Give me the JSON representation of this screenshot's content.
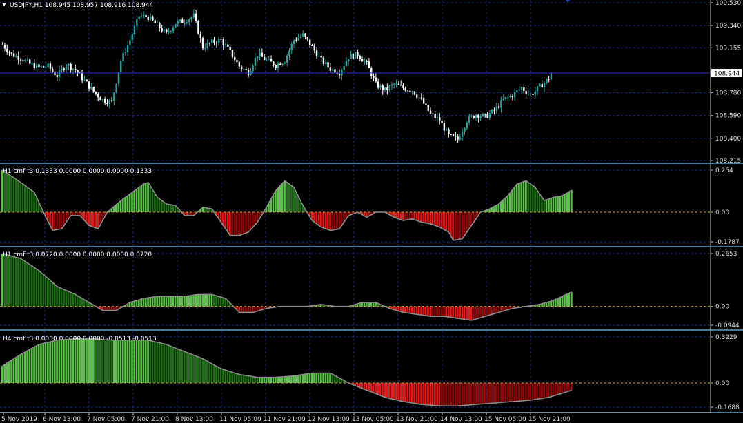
{
  "colors": {
    "background": "#000000",
    "grid": "#1c2b6b",
    "bull": "#2aa198",
    "bear": "#ffffff",
    "price_line": "#2b38c8",
    "separator": "#5fa0c8",
    "zero_line": "#c8b04a",
    "green_strong": "#5cc04a",
    "green_dark": "#1f6b16",
    "red_strong": "#e01818",
    "red_dark": "#8c0808",
    "curve": "#8c8c8c"
  },
  "chart_data": [
    {
      "type": "candlestick",
      "header": "USDJPY,H1  108.945 108.957 108.916 108.944",
      "y_ticks": [
        "109.530",
        "109.340",
        "109.155",
        "108.780",
        "108.590",
        "108.400",
        "108.215"
      ],
      "ylim": [
        108.215,
        109.53
      ],
      "current_price": "108.944",
      "close_path": [
        [
          0,
          109.18
        ],
        [
          4,
          109.1
        ],
        [
          8,
          109.07
        ],
        [
          12,
          109.02
        ],
        [
          16,
          108.99
        ],
        [
          20,
          109.0
        ],
        [
          24,
          108.92
        ],
        [
          28,
          109.02
        ],
        [
          32,
          108.97
        ],
        [
          36,
          108.88
        ],
        [
          40,
          108.79
        ],
        [
          44,
          108.72
        ],
        [
          48,
          108.7
        ],
        [
          52,
          109.05
        ],
        [
          56,
          109.22
        ],
        [
          60,
          109.42
        ],
        [
          64,
          109.41
        ],
        [
          68,
          109.34
        ],
        [
          72,
          109.27
        ],
        [
          76,
          109.36
        ],
        [
          80,
          109.38
        ],
        [
          84,
          109.42
        ],
        [
          88,
          109.16
        ],
        [
          92,
          109.2
        ],
        [
          96,
          109.22
        ],
        [
          100,
          109.12
        ],
        [
          104,
          109.0
        ],
        [
          108,
          108.95
        ],
        [
          112,
          109.1
        ],
        [
          116,
          109.05
        ],
        [
          120,
          109.01
        ],
        [
          124,
          109.05
        ],
        [
          128,
          109.22
        ],
        [
          132,
          109.26
        ],
        [
          136,
          109.16
        ],
        [
          140,
          109.05
        ],
        [
          144,
          108.98
        ],
        [
          148,
          108.95
        ],
        [
          152,
          109.08
        ],
        [
          156,
          109.1
        ],
        [
          160,
          109.02
        ],
        [
          164,
          108.85
        ],
        [
          168,
          108.8
        ],
        [
          172,
          108.85
        ],
        [
          176,
          108.82
        ],
        [
          180,
          108.8
        ],
        [
          184,
          108.72
        ],
        [
          188,
          108.6
        ],
        [
          192,
          108.55
        ],
        [
          196,
          108.42
        ],
        [
          200,
          108.39
        ],
        [
          204,
          108.55
        ],
        [
          208,
          108.6
        ],
        [
          212,
          108.58
        ],
        [
          216,
          108.63
        ],
        [
          220,
          108.72
        ],
        [
          224,
          108.76
        ],
        [
          228,
          108.82
        ],
        [
          232,
          108.76
        ],
        [
          236,
          108.83
        ],
        [
          240,
          108.9
        ],
        [
          241,
          108.944
        ]
      ]
    },
    {
      "type": "histogram",
      "header": "H1 cmf t3  0.1333 0.0000 0.0000 0.0000 0.1333",
      "y_ticks": [
        "0.254",
        "0.00",
        "-0.1787"
      ],
      "ylim": [
        -0.1787,
        0.254
      ],
      "values_path": [
        [
          0,
          0.254
        ],
        [
          8,
          0.18
        ],
        [
          14,
          0.12
        ],
        [
          18,
          0.0
        ],
        [
          22,
          -0.11
        ],
        [
          26,
          -0.1
        ],
        [
          30,
          -0.02
        ],
        [
          34,
          -0.02
        ],
        [
          38,
          -0.08
        ],
        [
          42,
          -0.1
        ],
        [
          46,
          0.0
        ],
        [
          52,
          0.07
        ],
        [
          58,
          0.13
        ],
        [
          62,
          0.17
        ],
        [
          64,
          0.18
        ],
        [
          68,
          0.09
        ],
        [
          72,
          0.05
        ],
        [
          76,
          0.04
        ],
        [
          80,
          -0.02
        ],
        [
          84,
          -0.02
        ],
        [
          88,
          0.03
        ],
        [
          92,
          0.02
        ],
        [
          96,
          -0.06
        ],
        [
          100,
          -0.14
        ],
        [
          104,
          -0.14
        ],
        [
          108,
          -0.12
        ],
        [
          112,
          -0.06
        ],
        [
          116,
          0.03
        ],
        [
          120,
          0.13
        ],
        [
          124,
          0.19
        ],
        [
          128,
          0.15
        ],
        [
          132,
          0.04
        ],
        [
          136,
          -0.05
        ],
        [
          140,
          -0.09
        ],
        [
          144,
          -0.11
        ],
        [
          148,
          -0.1
        ],
        [
          152,
          -0.02
        ],
        [
          156,
          -0.0
        ],
        [
          160,
          -0.03
        ],
        [
          164,
          0.0
        ],
        [
          168,
          0.0
        ],
        [
          172,
          -0.03
        ],
        [
          176,
          -0.05
        ],
        [
          180,
          -0.04
        ],
        [
          184,
          -0.06
        ],
        [
          188,
          -0.07
        ],
        [
          192,
          -0.09
        ],
        [
          196,
          -0.12
        ],
        [
          198,
          -0.17
        ],
        [
          202,
          -0.16
        ],
        [
          206,
          -0.08
        ],
        [
          210,
          0.0
        ],
        [
          214,
          0.02
        ],
        [
          218,
          0.05
        ],
        [
          222,
          0.1
        ],
        [
          226,
          0.17
        ],
        [
          230,
          0.19
        ],
        [
          234,
          0.15
        ],
        [
          238,
          0.07
        ],
        [
          242,
          0.09
        ],
        [
          246,
          0.1
        ],
        [
          250,
          0.1333
        ]
      ]
    },
    {
      "type": "histogram",
      "header": "H1 cmf t3  0.0720 0.0000 0.0000 0.0000 0.0720",
      "y_ticks": [
        "0.2653",
        "0.00",
        "-0.0944"
      ],
      "ylim": [
        -0.0944,
        0.2653
      ],
      "values_path": [
        [
          0,
          0.2653
        ],
        [
          8,
          0.24
        ],
        [
          16,
          0.18
        ],
        [
          24,
          0.1
        ],
        [
          32,
          0.06
        ],
        [
          38,
          0.02
        ],
        [
          44,
          -0.02
        ],
        [
          50,
          -0.02
        ],
        [
          56,
          0.02
        ],
        [
          62,
          0.04
        ],
        [
          68,
          0.05
        ],
        [
          74,
          0.05
        ],
        [
          80,
          0.05
        ],
        [
          86,
          0.06
        ],
        [
          92,
          0.06
        ],
        [
          98,
          0.04
        ],
        [
          104,
          -0.03
        ],
        [
          110,
          -0.03
        ],
        [
          116,
          -0.01
        ],
        [
          122,
          0.0
        ],
        [
          128,
          0.0
        ],
        [
          134,
          0.0
        ],
        [
          140,
          0.01
        ],
        [
          146,
          0.0
        ],
        [
          152,
          -0.0
        ],
        [
          158,
          0.02
        ],
        [
          164,
          0.02
        ],
        [
          170,
          -0.01
        ],
        [
          176,
          -0.03
        ],
        [
          182,
          -0.04
        ],
        [
          188,
          -0.05
        ],
        [
          194,
          -0.05
        ],
        [
          200,
          -0.06
        ],
        [
          206,
          -0.07
        ],
        [
          212,
          -0.05
        ],
        [
          218,
          -0.03
        ],
        [
          224,
          -0.01
        ],
        [
          230,
          0.0
        ],
        [
          236,
          0.01
        ],
        [
          242,
          0.03
        ],
        [
          250,
          0.072
        ]
      ]
    },
    {
      "type": "histogram",
      "header": "H4 cmf t3  0.0000 0.0000 0.0000 -0.0513 -0.0513",
      "y_ticks": [
        "0.3229",
        "0.00",
        "-0.1688"
      ],
      "ylim": [
        -0.1688,
        0.3229
      ],
      "values_path": [
        [
          0,
          0.12
        ],
        [
          8,
          0.2
        ],
        [
          16,
          0.27
        ],
        [
          24,
          0.3
        ],
        [
          32,
          0.31
        ],
        [
          40,
          0.31
        ],
        [
          48,
          0.3
        ],
        [
          56,
          0.3
        ],
        [
          64,
          0.3
        ],
        [
          72,
          0.27
        ],
        [
          80,
          0.22
        ],
        [
          88,
          0.17
        ],
        [
          96,
          0.1
        ],
        [
          104,
          0.06
        ],
        [
          112,
          0.04
        ],
        [
          120,
          0.04
        ],
        [
          128,
          0.05
        ],
        [
          136,
          0.07
        ],
        [
          144,
          0.07
        ],
        [
          152,
          0.0
        ],
        [
          160,
          -0.05
        ],
        [
          168,
          -0.1
        ],
        [
          176,
          -0.13
        ],
        [
          184,
          -0.15
        ],
        [
          192,
          -0.16
        ],
        [
          200,
          -0.16
        ],
        [
          208,
          -0.15
        ],
        [
          216,
          -0.14
        ],
        [
          224,
          -0.13
        ],
        [
          232,
          -0.12
        ],
        [
          240,
          -0.1
        ],
        [
          250,
          -0.0513
        ]
      ]
    }
  ],
  "x_labels": [
    "5 Nov 2019",
    "6 Nov 13:00",
    "7 Nov 05:00",
    "7 Nov 21:00",
    "8 Nov 13:00",
    "11 Nov 05:00",
    "11 Nov 21:00",
    "12 Nov 13:00",
    "13 Nov 05:00",
    "13 Nov 21:00",
    "14 Nov 13:00",
    "15 Nov 05:00",
    "15 Nov 21:00"
  ]
}
